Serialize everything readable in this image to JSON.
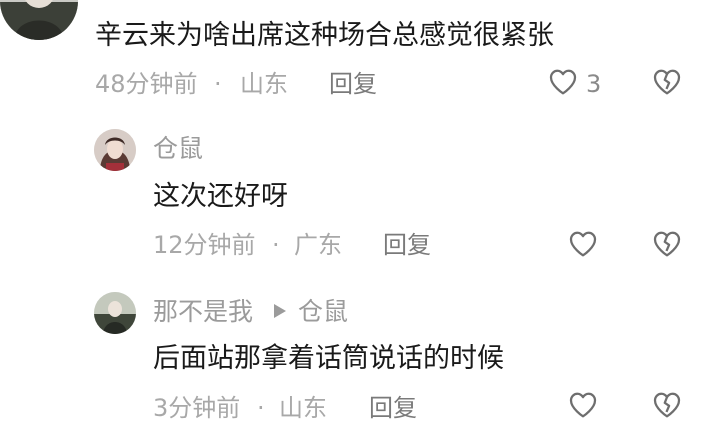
{
  "comments": [
    {
      "text": "辛云来为啥出席这种场合总感觉很紧张",
      "time": "48分钟前",
      "location": "山东",
      "reply_label": "回复",
      "like_count": "3"
    },
    {
      "username": "仓鼠",
      "text": "这次还好呀",
      "time": "12分钟前",
      "location": "广东",
      "reply_label": "回复"
    },
    {
      "username": "那不是我",
      "reply_to": "仓鼠",
      "text": "后面站那拿着话筒说话的时候",
      "time": "3分钟前",
      "location": "山东",
      "reply_label": "回复"
    }
  ],
  "meta_separator": "·",
  "icons": {
    "like": "heart-outline-icon",
    "dislike": "broken-heart-icon",
    "reply_arrow": "play-triangle-icon"
  },
  "colors": {
    "text_primary": "#1a1a1a",
    "text_secondary": "#9b9b9b",
    "icon": "#6e6e6e"
  }
}
